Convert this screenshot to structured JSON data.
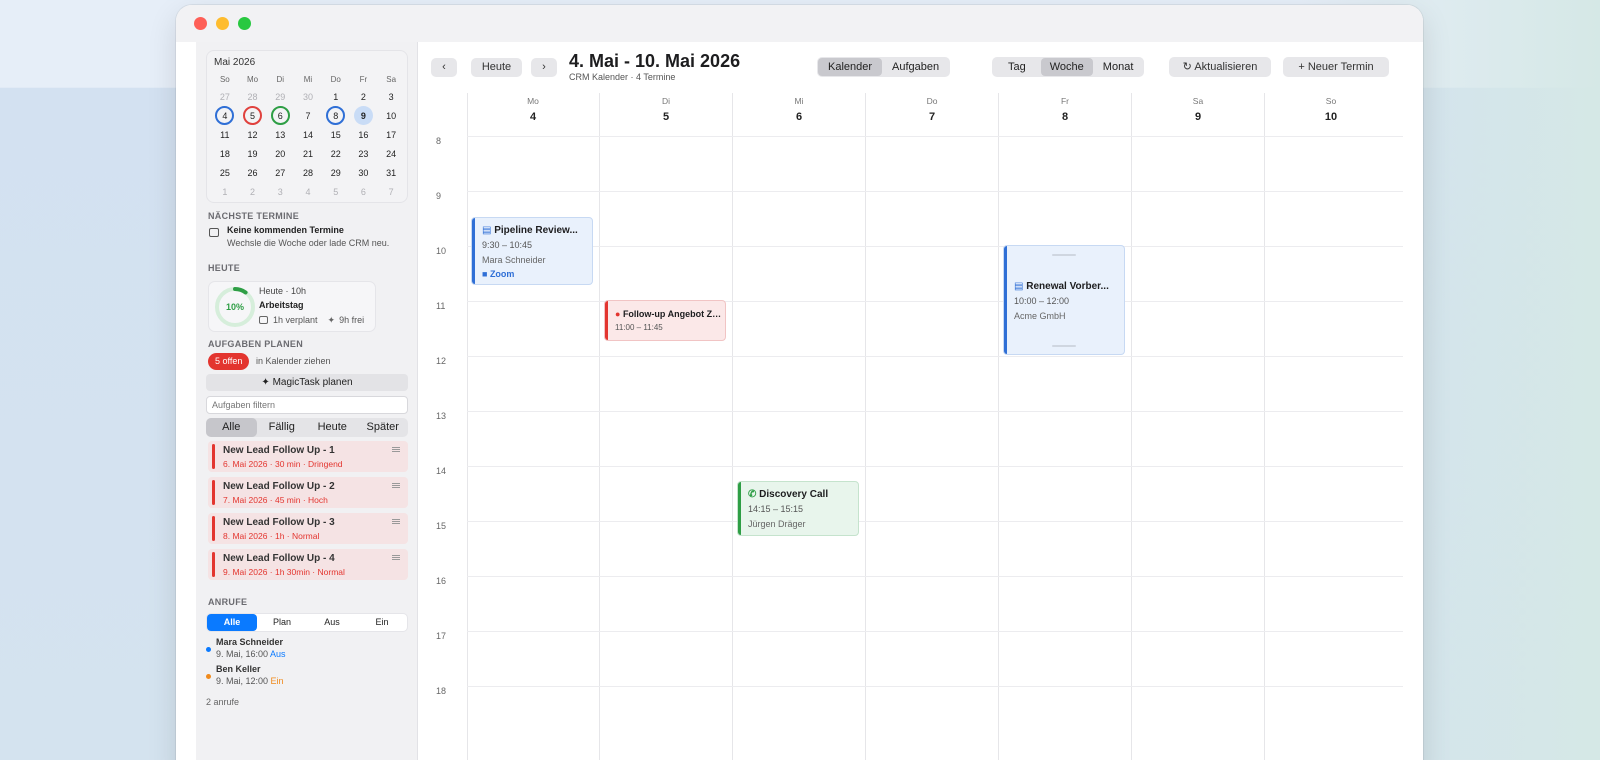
{
  "colors": {
    "accent": "#0a7aff",
    "event_blue": "#2f6fd6",
    "event_red": "#e3352f",
    "event_green": "#2e9e45"
  },
  "mini_calendar": {
    "title": "Mai 2026",
    "weekdays": [
      "So",
      "Mo",
      "Di",
      "Mi",
      "Do",
      "Fr",
      "Sa"
    ],
    "days": [
      {
        "n": "27",
        "muted": true
      },
      {
        "n": "28",
        "muted": true
      },
      {
        "n": "29",
        "muted": true
      },
      {
        "n": "30",
        "muted": true
      },
      {
        "n": "1"
      },
      {
        "n": "2"
      },
      {
        "n": "3"
      },
      {
        "n": "4",
        "ring": "blue"
      },
      {
        "n": "5",
        "ring": "red"
      },
      {
        "n": "6",
        "ring": "green"
      },
      {
        "n": "7"
      },
      {
        "n": "8",
        "ring": "blue"
      },
      {
        "n": "9",
        "selected": true
      },
      {
        "n": "10"
      },
      {
        "n": "11"
      },
      {
        "n": "12"
      },
      {
        "n": "13"
      },
      {
        "n": "14"
      },
      {
        "n": "15"
      },
      {
        "n": "16"
      },
      {
        "n": "17"
      },
      {
        "n": "18"
      },
      {
        "n": "19"
      },
      {
        "n": "20"
      },
      {
        "n": "21"
      },
      {
        "n": "22"
      },
      {
        "n": "23"
      },
      {
        "n": "24"
      },
      {
        "n": "25"
      },
      {
        "n": "26"
      },
      {
        "n": "27"
      },
      {
        "n": "28"
      },
      {
        "n": "29"
      },
      {
        "n": "30"
      },
      {
        "n": "31"
      },
      {
        "n": "1",
        "muted": true
      },
      {
        "n": "2",
        "muted": true
      },
      {
        "n": "3",
        "muted": true
      },
      {
        "n": "4",
        "muted": true
      },
      {
        "n": "5",
        "muted": true
      },
      {
        "n": "6",
        "muted": true
      },
      {
        "n": "7",
        "muted": true
      }
    ]
  },
  "sidebar": {
    "next_header": "NÄCHSTE TERMINE",
    "next_title": "Keine kommenden Termine",
    "next_sub": "Wechsle die Woche oder lade CRM neu.",
    "today_header": "HEUTE",
    "today_pct": "10%",
    "today_progress": 0.1,
    "today_line1": "Heute · 10h",
    "today_line2": "Arbeitstag",
    "today_planned": "1h verplant",
    "today_free": "9h frei",
    "tasks_header": "AUFGABEN PLANEN",
    "open_badge": "5 offen",
    "open_hint": "in Kalender ziehen",
    "magic_button": "MagicTask planen",
    "filter_placeholder": "Aufgaben filtern",
    "task_tabs": [
      "Alle",
      "Fällig",
      "Heute",
      "Später"
    ],
    "tasks": [
      {
        "title": "New Lead Follow Up - 1",
        "meta": "6. Mai 2026 · 30 min · Dringend"
      },
      {
        "title": "New Lead Follow Up - 2",
        "meta": "7. Mai 2026 · 45 min · Hoch"
      },
      {
        "title": "New Lead Follow Up - 3",
        "meta": "8. Mai 2026 · 1h · Normal"
      },
      {
        "title": "New Lead Follow Up - 4",
        "meta": "9. Mai 2026 · 1h 30min · Normal"
      }
    ],
    "calls_header": "ANRUFE",
    "call_tabs": [
      "Alle",
      "Plan",
      "Aus",
      "Ein"
    ],
    "calls": [
      {
        "name": "Mara Schneider",
        "when": "9. Mai, 16:00",
        "dir": "Aus",
        "color": "#0a7aff"
      },
      {
        "name": "Ben Keller",
        "when": "9. Mai, 12:00",
        "dir": "Ein",
        "color": "#f08a1c"
      }
    ],
    "calls_count": "2 anrufe"
  },
  "toolbar": {
    "today_btn": "Heute",
    "prev_icon": "chevron-left-icon",
    "next_icon": "chevron-right-icon",
    "range_title": "4. Mai - 10. Mai 2026",
    "range_sub": "CRM Kalender · 4 Termine",
    "view_kalender": "Kalender",
    "view_aufgaben": "Aufgaben",
    "mode_tag": "Tag",
    "mode_woche": "Woche",
    "mode_monat": "Monat",
    "refresh_btn": "Aktualisieren",
    "new_btn": "Neuer Termin"
  },
  "week": {
    "days": [
      {
        "wd": "Mo",
        "n": "4"
      },
      {
        "wd": "Di",
        "n": "5"
      },
      {
        "wd": "Mi",
        "n": "6"
      },
      {
        "wd": "Do",
        "n": "7"
      },
      {
        "wd": "Fr",
        "n": "8"
      },
      {
        "wd": "Sa",
        "n": "9"
      },
      {
        "wd": "So",
        "n": "10"
      }
    ],
    "hours": [
      "8",
      "9",
      "10",
      "11",
      "12",
      "13",
      "14",
      "15",
      "16",
      "17",
      "18"
    ]
  },
  "events": {
    "pipeline": {
      "title": "Pipeline Review...",
      "time": "9:30 – 10:45",
      "person": "Mara Schneider",
      "link": "Zoom"
    },
    "followup": {
      "title": "Follow-up Angebot ZC...",
      "time": "11:00 – 11:45"
    },
    "discovery": {
      "title": "Discovery Call",
      "time": "14:15 – 15:15",
      "person": "Jürgen Dräger"
    },
    "renewal": {
      "title": "Renewal Vorber...",
      "time": "10:00 – 12:00",
      "company": "Acme GmbH"
    }
  }
}
